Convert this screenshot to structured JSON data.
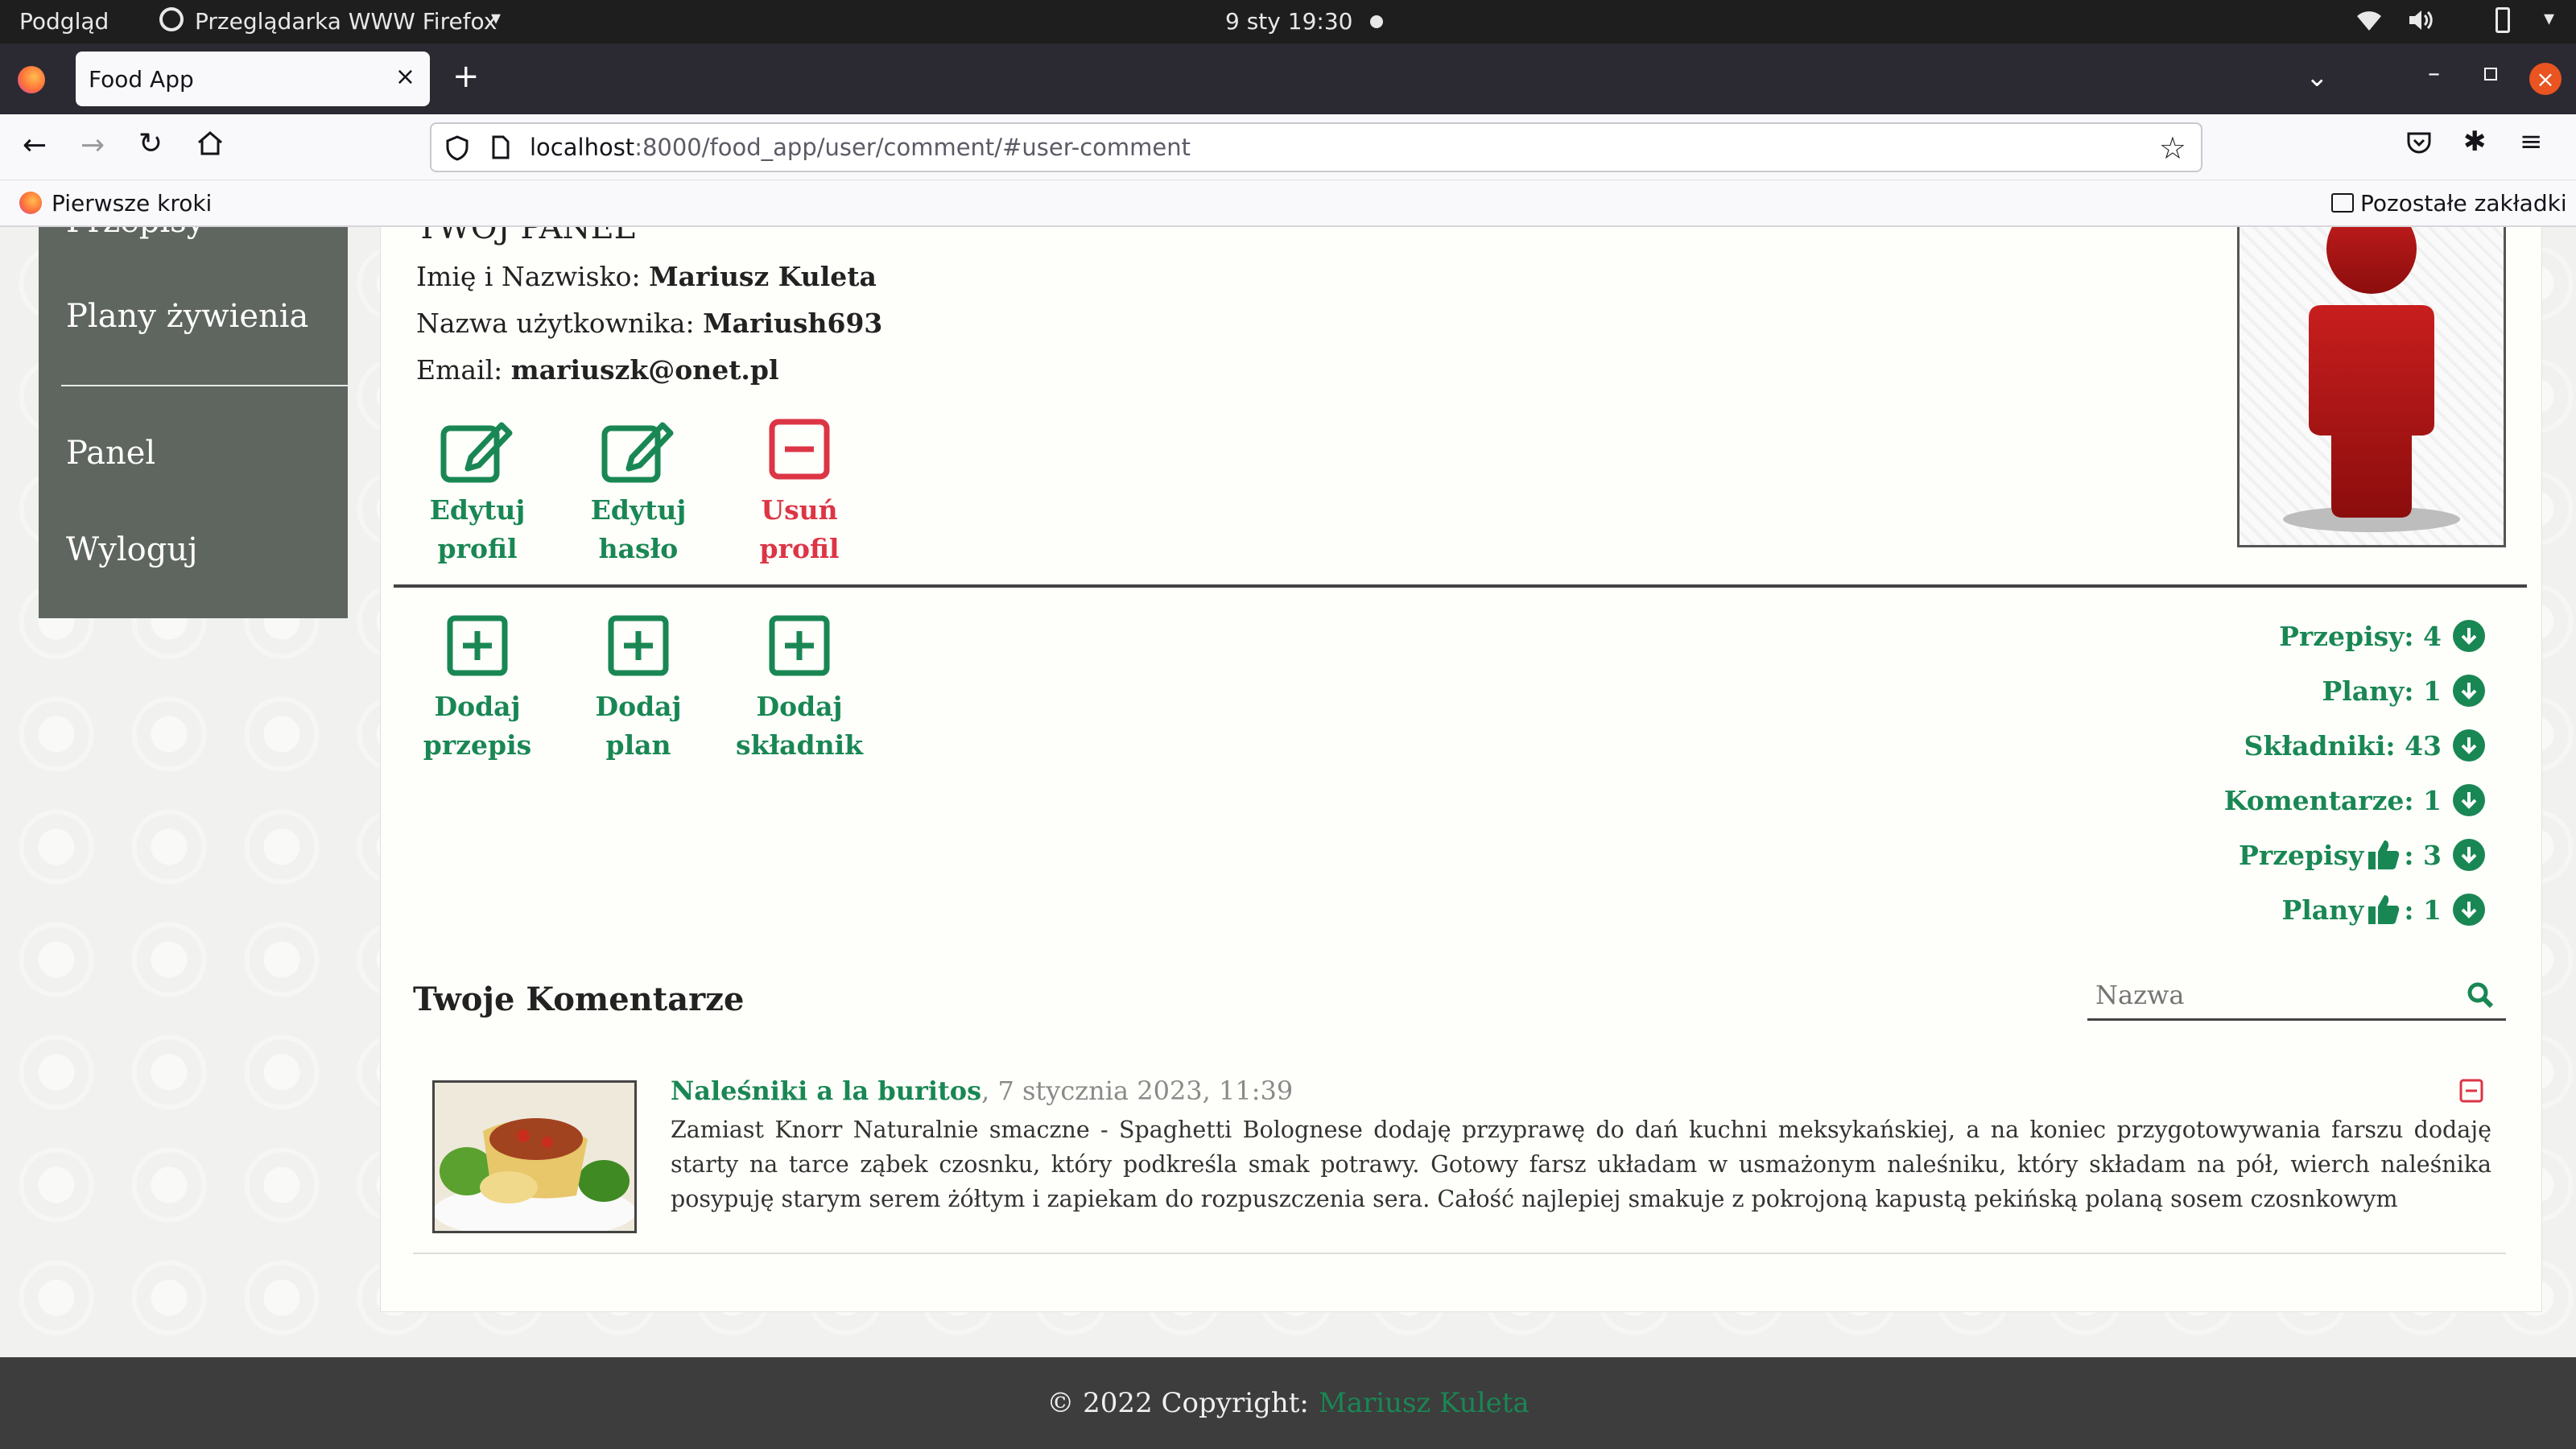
{
  "system_bar": {
    "left_label": "Podgląd",
    "app_label": "Przeglądarka WWW Firefox",
    "datetime": "9 sty  19:30"
  },
  "browser": {
    "tab_title": "Food App",
    "url_host": "localhost",
    "url_rest": ":8000/food_app/user/comment/#user-comment",
    "bookmark_left": "Pierwsze kroki",
    "bookmark_right": "Pozostałe zakładki"
  },
  "sidebar": {
    "items": [
      {
        "label": "Przepisy"
      },
      {
        "label": "Plany żywienia"
      },
      {
        "label": "Panel"
      },
      {
        "label": "Wyloguj"
      }
    ]
  },
  "panel": {
    "title": "TWÓJ PANEL",
    "fullname_label": "Imię i Nazwisko:",
    "fullname": "Mariusz Kuleta",
    "username_label": "Nazwa użytkownika:",
    "username": "Mariush693",
    "email_label": "Email:",
    "email": "mariuszk@onet.pl",
    "actions": [
      {
        "line1": "Edytuj",
        "line2": "profil"
      },
      {
        "line1": "Edytuj",
        "line2": "hasło"
      },
      {
        "line1": "Usuń",
        "line2": "profil"
      }
    ],
    "add_actions": [
      {
        "line1": "Dodaj",
        "line2": "przepis"
      },
      {
        "line1": "Dodaj",
        "line2": "plan"
      },
      {
        "line1": "Dodaj",
        "line2": "składnik"
      }
    ],
    "stats": [
      {
        "label": "Przepisy: 4"
      },
      {
        "label": "Plany: 1"
      },
      {
        "label": "Składniki: 43"
      },
      {
        "label": "Komentarze: 1"
      },
      {
        "label_a": "Przepisy",
        "label_b": ": 3"
      },
      {
        "label_a": "Plany",
        "label_b": ": 1"
      }
    ]
  },
  "comments": {
    "heading": "Twoje Komentarze",
    "search_placeholder": "Nazwa",
    "items": [
      {
        "recipe": "Naleśniki a la buritos",
        "date": ", 7 stycznia 2023, 11:39",
        "text": "Zamiast Knorr Naturalnie smaczne - Spaghetti Bolognese dodaję przyprawę do dań kuchni meksykańskiej, a na koniec przygotowywania farszu dodaję starty na tarce ząbek czosnku, który podkreśla smak potrawy. Gotowy farsz układam w usmażonym naleśniku, który składam na pół, wierch naleśnika posypuję starym serem żółtym i zapiekam do rozpuszczenia sera. Całość najlepiej smakuje z pokrojoną kapustą pekińską polaną sosem czosnkowym"
      }
    ]
  },
  "footer": {
    "copyright": "© 2022 Copyright:",
    "author": "Mariusz Kuleta"
  },
  "colors": {
    "accent": "#198754",
    "danger": "#dc3545",
    "sidebar": "#5f665f",
    "footer": "#3d3d3d"
  }
}
